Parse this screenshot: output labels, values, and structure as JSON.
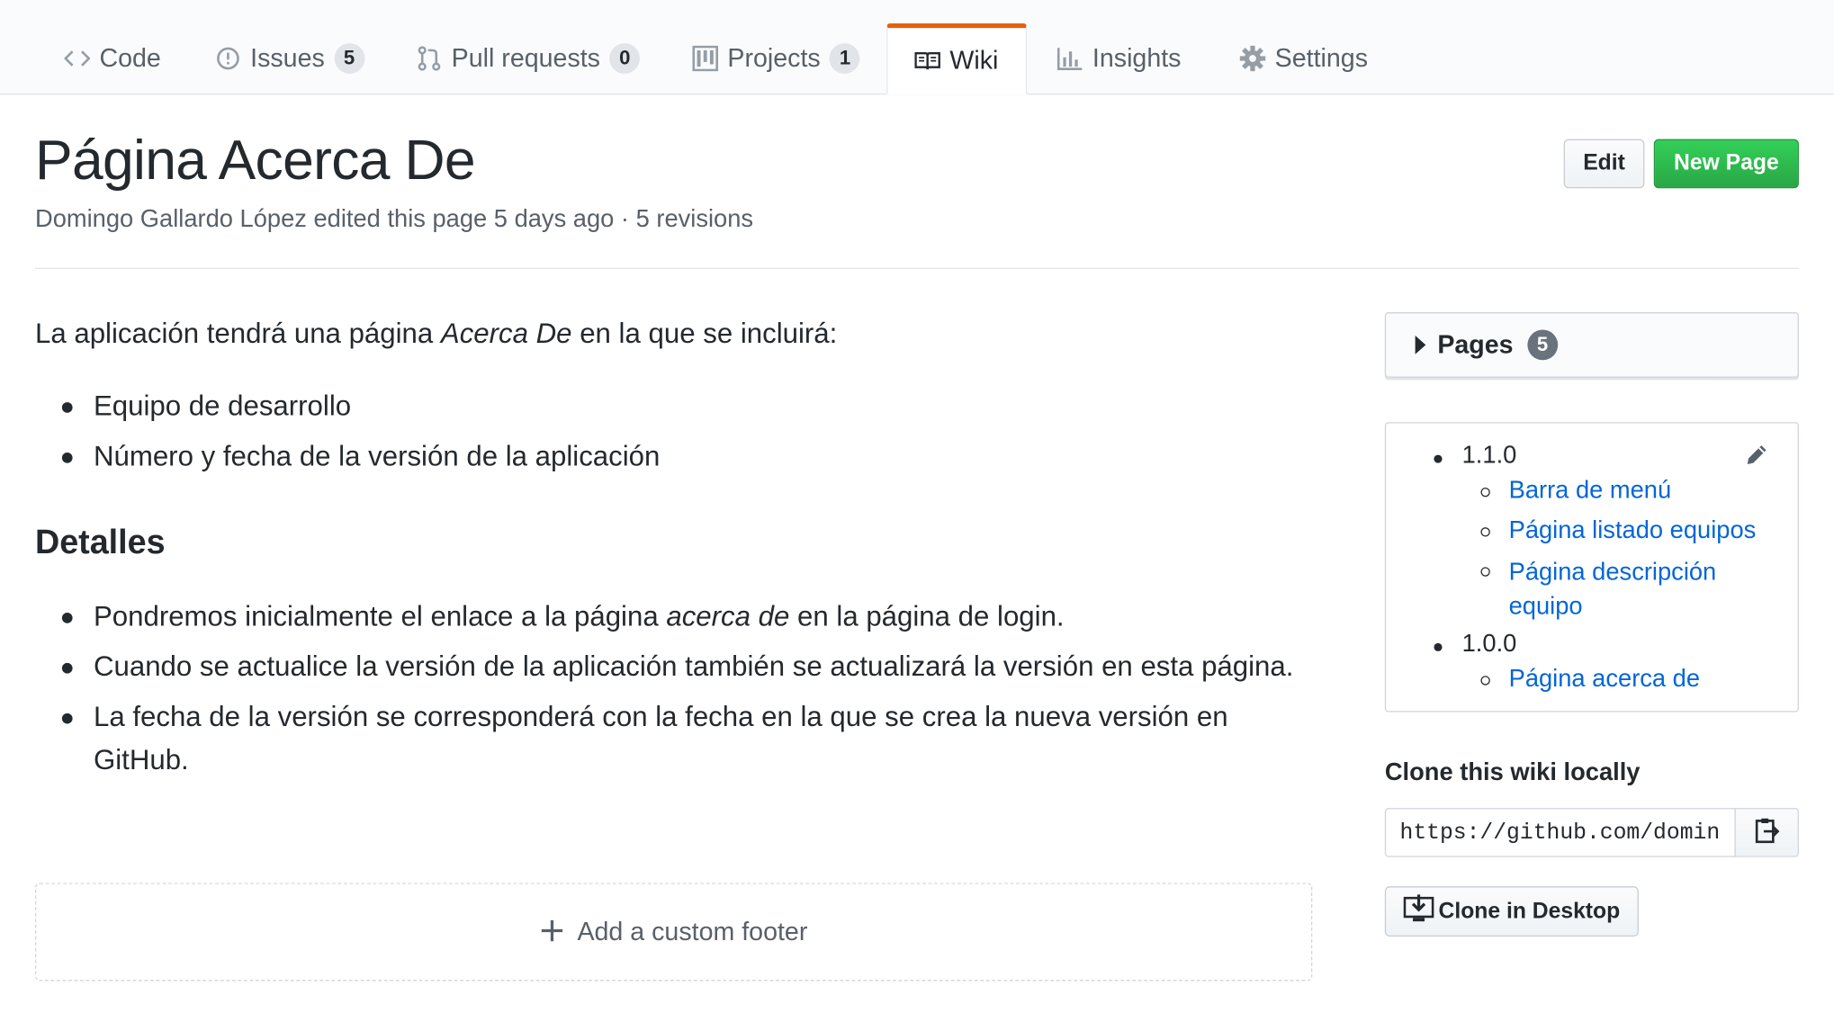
{
  "tabs": [
    {
      "label": "Code",
      "icon": "code-icon"
    },
    {
      "label": "Issues",
      "count": "5",
      "icon": "issue-icon"
    },
    {
      "label": "Pull requests",
      "count": "0",
      "icon": "pull-request-icon"
    },
    {
      "label": "Projects",
      "count": "1",
      "icon": "project-icon"
    },
    {
      "label": "Wiki",
      "icon": "book-icon",
      "selected": true
    },
    {
      "label": "Insights",
      "icon": "graph-icon"
    },
    {
      "label": "Settings",
      "icon": "gear-icon"
    }
  ],
  "colors": {
    "accent": "#e36209",
    "link": "#0366d6",
    "primary_button": "#28a745"
  },
  "header": {
    "title": "Página Acerca De",
    "meta": "Domingo Gallardo López edited this page 5 days ago · 5 revisions",
    "edit_label": "Edit",
    "new_page_label": "New Page"
  },
  "content": {
    "intro_before": "La aplicación tendrá una página ",
    "intro_em": "Acerca De",
    "intro_after": " en la que se incluirá:",
    "list1": [
      "Equipo de desarrollo",
      "Número y fecha de la versión de la aplicación"
    ],
    "heading": "Detalles",
    "d1_before": "Pondremos inicialmente el enlace a la página ",
    "d1_em": "acerca de",
    "d1_after": " en la página de login.",
    "d2": "Cuando se actualice la versión de la aplicación también se actualizará la versión en esta página.",
    "d3": "La fecha de la versión se corresponderá con la fecha en la que se crea la nueva versión en GitHub."
  },
  "footer": {
    "add_label": "Add a custom footer"
  },
  "sidebar": {
    "pages_label": "Pages",
    "pages_count": "5",
    "toc": {
      "v1": "1.1.0",
      "v1_links": [
        "Barra de menú",
        "Página listado equipos",
        "Página descripción equipo"
      ],
      "v2": "1.0.0",
      "v2_links": [
        "Página acerca de"
      ]
    },
    "clone_heading": "Clone this wiki locally",
    "clone_url": "https://github.com/domingogallardo/mads-todolist-guia.wiki.git",
    "clone_desktop_label": "Clone in Desktop"
  }
}
